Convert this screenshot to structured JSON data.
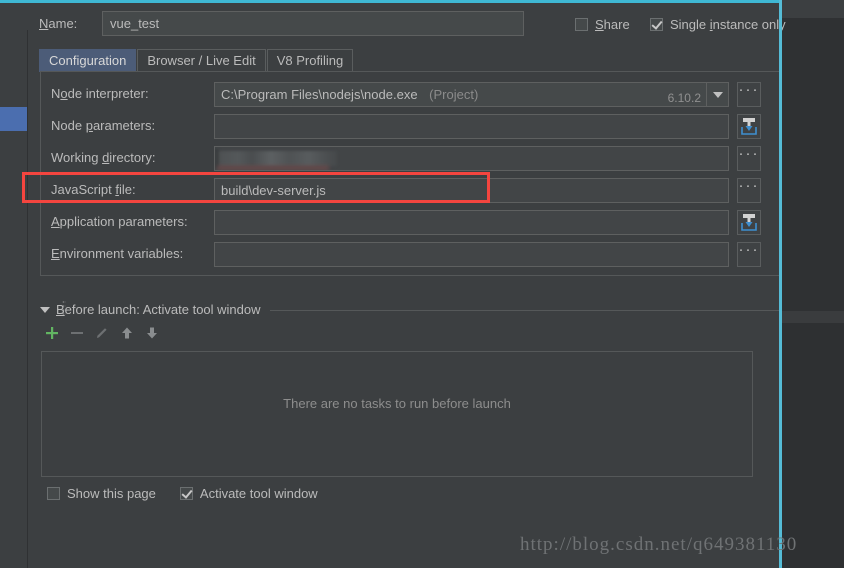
{
  "window": {
    "accent_color": "#3fb8d4",
    "panel_bg": "#3c3f41",
    "field_bg": "#45494a",
    "selection_color": "#4b6eaf",
    "annotation_color": "#f4453f"
  },
  "header": {
    "name_label": "Name:",
    "name_value": "vue_test",
    "share_label": "Share",
    "share_checked": false,
    "single_instance_label": "Single instance only",
    "single_instance_checked": true
  },
  "tabs": [
    {
      "label": "Configuration",
      "active": true
    },
    {
      "label": "Browser / Live Edit",
      "active": false
    },
    {
      "label": "V8 Profiling",
      "active": false
    }
  ],
  "form": {
    "rows": [
      {
        "label": "Node interpreter:",
        "value": "C:\\Program Files\\nodejs\\node.exe",
        "suffix": "(Project)",
        "version": "6.10.2",
        "control": "combo",
        "button": "ellipsis"
      },
      {
        "label": "Node parameters:",
        "value": "",
        "control": "text",
        "button": "expand"
      },
      {
        "label": "Working directory:",
        "value": "",
        "redacted": true,
        "control": "text",
        "button": "ellipsis"
      },
      {
        "label": "JavaScript file:",
        "value": "build\\dev-server.js",
        "control": "text",
        "button": "ellipsis",
        "highlighted": true
      },
      {
        "label": "Application parameters:",
        "value": "",
        "control": "text",
        "button": "expand"
      },
      {
        "label": "Environment variables:",
        "value": "",
        "control": "text",
        "button": "ellipsis"
      }
    ]
  },
  "before_launch": {
    "title": "Before launch: Activate tool window",
    "toolbar": [
      {
        "name": "add-icon",
        "glyph": "+",
        "color": "#62b562",
        "enabled": true
      },
      {
        "name": "remove-icon",
        "glyph": "−",
        "color": "#6d7072",
        "enabled": false
      },
      {
        "name": "edit-icon",
        "glyph": "✎",
        "color": "#6d7072",
        "enabled": false
      },
      {
        "name": "move-up-icon",
        "glyph": "↑",
        "color": "#8a8d8f",
        "enabled": false
      },
      {
        "name": "move-down-icon",
        "glyph": "↓",
        "color": "#8a8d8f",
        "enabled": false
      }
    ],
    "empty_message": "There are no tasks to run before launch"
  },
  "bottom": {
    "show_page_label": "Show this page",
    "show_page_checked": false,
    "activate_window_label": "Activate tool window",
    "activate_window_checked": true
  },
  "watermark": {
    "text": "http://blog.csdn.net/q649381130"
  }
}
